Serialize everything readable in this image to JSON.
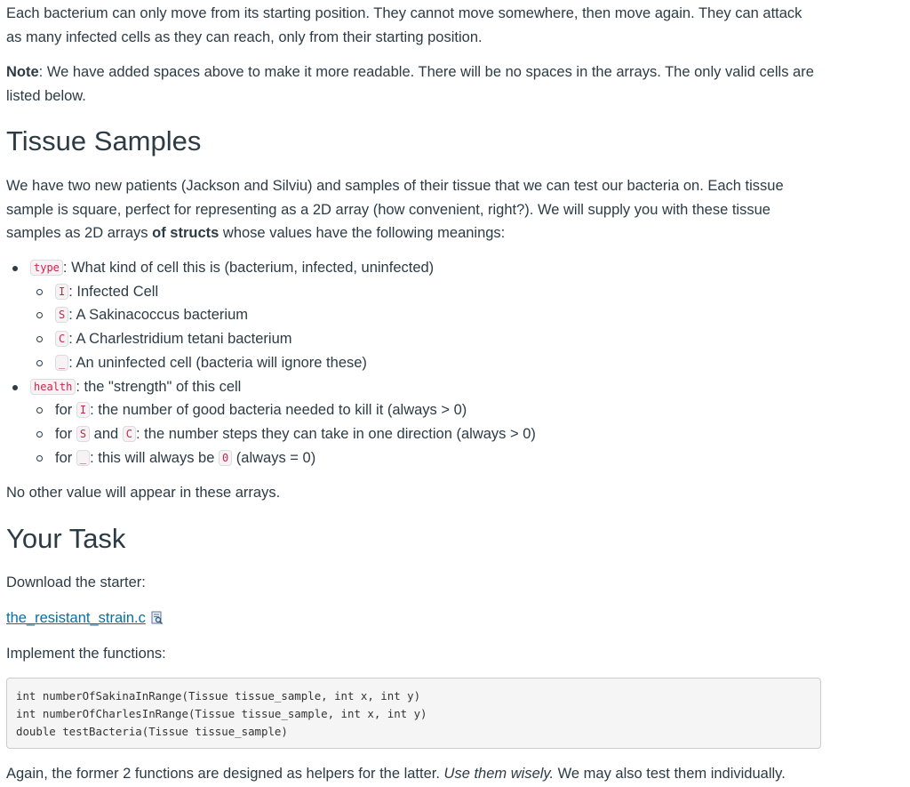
{
  "intro": {
    "para1": "Each bacterium can only move from its starting position. They cannot move somewhere, then move again. They can attack as many infected cells as they can reach, only from their starting position.",
    "note_label": "Note",
    "note_text": ": We have added spaces above to make it more readable. There will be no spaces in the arrays. The only valid cells are listed below."
  },
  "tissue_section": {
    "heading": "Tissue Samples",
    "para_before_bold": "We have two new patients (Jackson and Silviu) and samples of their tissue that we can test our bacteria on. Each tissue sample is square, perfect for representing as a 2D array (how convenient, right?). We will supply you with these tissue samples as 2D arrays ",
    "para_bold": "of structs",
    "para_after_bold": " whose values have the following meanings:",
    "fields": [
      {
        "code": "type",
        "description": ": What kind of cell this is (bacterium, infected, uninfected)",
        "items": [
          {
            "prefix": "",
            "codes": [
              "I"
            ],
            "text": ": Infected Cell"
          },
          {
            "prefix": "",
            "codes": [
              "S"
            ],
            "text": ": A Sakinacoccus bacterium"
          },
          {
            "prefix": "",
            "codes": [
              "C"
            ],
            "text": ": A Charlestridium tetani bacterium"
          },
          {
            "prefix": "",
            "codes": [
              "_"
            ],
            "text": ": An uninfected cell (bacteria will ignore these)"
          }
        ]
      },
      {
        "code": "health",
        "description": ": the \"strength\" of this cell",
        "items": [
          {
            "prefix": "for ",
            "code1": "I",
            "text": ": the number of good bacteria needed to kill it (always > 0)"
          },
          {
            "prefix": "for ",
            "code1": "S",
            "mid": " and ",
            "code2": "C",
            "text": ": the number steps they can take in one direction (always > 0)"
          },
          {
            "prefix": "for ",
            "code1": "_",
            "text": ": this will always be ",
            "code2": "0",
            "tail": " (always = 0)"
          }
        ]
      }
    ],
    "closing": "No other value will appear in these arrays."
  },
  "task_section": {
    "heading": "Your Task",
    "download_text": "Download the starter:",
    "file_link": "the_resistant_strain.c",
    "file_icon": "document-preview-icon",
    "implement_text": "Implement the functions:",
    "code_lines": [
      "int numberOfSakinaInRange(Tissue tissue_sample, int x, int y)",
      "int numberOfCharlesInRange(Tissue tissue_sample, int x, int y)",
      "double testBacteria(Tissue tissue_sample)"
    ],
    "again_text_1": "Again, the former 2 functions are designed as helpers for the latter. ",
    "again_em": "Use them wisely.",
    "again_text_2": " We may also test them individually."
  },
  "colors": {
    "text": "#2d3b45",
    "link": "#0770a3",
    "code_text": "#c7254e"
  }
}
